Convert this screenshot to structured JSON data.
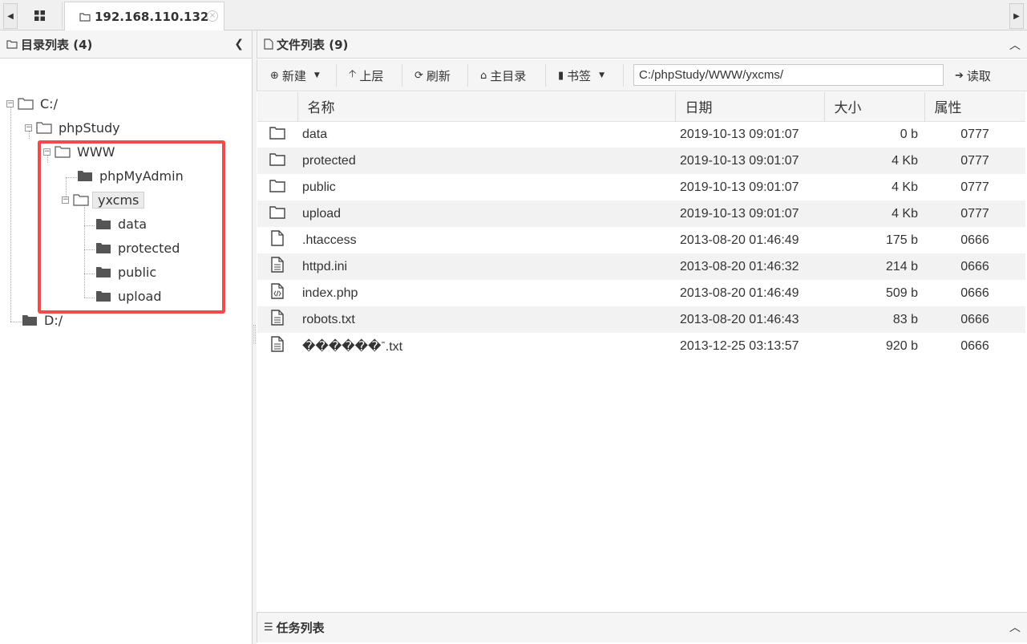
{
  "tabs": [
    {
      "label": "192.168.110.132",
      "active": true
    }
  ],
  "left_panel": {
    "title": "目录列表 (4)",
    "tree": {
      "c_drive": "C:/",
      "phpstudy": "phpStudy",
      "www": "WWW",
      "phpmyadmin": "phpMyAdmin",
      "yxcms": "yxcms",
      "data": "data",
      "protected": "protected",
      "public": "public",
      "upload": "upload",
      "d_drive": "D:/"
    }
  },
  "right_panel": {
    "title": "文件列表 (9)",
    "toolbar": {
      "new": "新建",
      "up": "上层",
      "refresh": "刷新",
      "home": "主目录",
      "bookmark": "书签",
      "path": "C:/phpStudy/WWW/yxcms/",
      "read": "读取"
    },
    "columns": {
      "name": "名称",
      "date": "日期",
      "size": "大小",
      "perm": "属性"
    },
    "files": [
      {
        "icon": "folder-icon",
        "name": "data",
        "date": "2019-10-13 09:01:07",
        "size": "0 b",
        "perm": "0777"
      },
      {
        "icon": "folder-icon",
        "name": "protected",
        "date": "2019-10-13 09:01:07",
        "size": "4 Kb",
        "perm": "0777"
      },
      {
        "icon": "folder-icon",
        "name": "public",
        "date": "2019-10-13 09:01:07",
        "size": "4 Kb",
        "perm": "0777"
      },
      {
        "icon": "folder-icon",
        "name": "upload",
        "date": "2019-10-13 09:01:07",
        "size": "4 Kb",
        "perm": "0777"
      },
      {
        "icon": "file-icon",
        "name": ".htaccess",
        "date": "2013-08-20 01:46:49",
        "size": "175 b",
        "perm": "0666"
      },
      {
        "icon": "text-file-icon",
        "name": "httpd.ini",
        "date": "2013-08-20 01:46:32",
        "size": "214 b",
        "perm": "0666"
      },
      {
        "icon": "code-file-icon",
        "name": "index.php",
        "date": "2013-08-20 01:46:49",
        "size": "509 b",
        "perm": "0666"
      },
      {
        "icon": "text-file-icon",
        "name": "robots.txt",
        "date": "2013-08-20 01:46:43",
        "size": "83 b",
        "perm": "0666"
      },
      {
        "icon": "text-file-icon",
        "name": "������ˉ.txt",
        "date": "2013-12-25 03:13:57",
        "size": "920 b",
        "perm": "0666"
      }
    ]
  },
  "task_panel": {
    "title": "任务列表"
  }
}
